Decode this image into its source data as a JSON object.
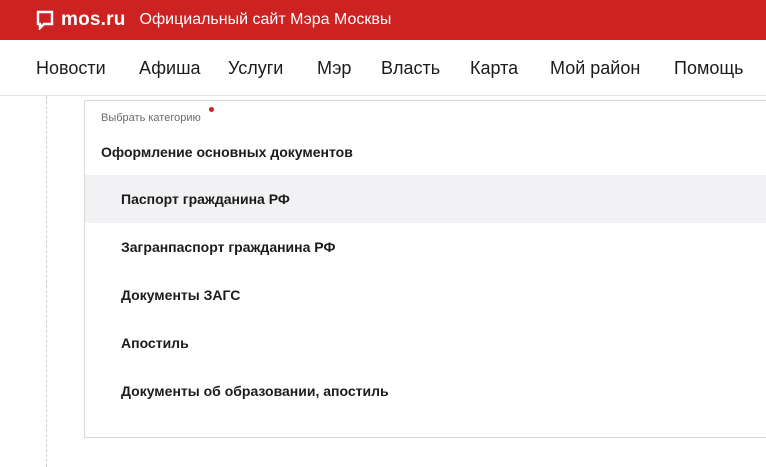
{
  "header": {
    "logo_text": "mos.ru",
    "site_title": "Официальный сайт Мэра Москвы",
    "brand_color": "#cc2222"
  },
  "nav": {
    "items": [
      {
        "label": "Новости"
      },
      {
        "label": "Афиша"
      },
      {
        "label": "Услуги"
      },
      {
        "label": "Мэр"
      },
      {
        "label": "Власть"
      },
      {
        "label": "Карта"
      },
      {
        "label": "Мой район"
      },
      {
        "label": "Помощь"
      }
    ]
  },
  "category_select": {
    "label": "Выбрать категорию",
    "selected": "Оформление основных документов",
    "options": [
      {
        "label": "Паспорт гражданина РФ",
        "highlighted": true
      },
      {
        "label": "Загранпаспорт гражданина РФ"
      },
      {
        "label": "Документы ЗАГС"
      },
      {
        "label": "Апостиль"
      },
      {
        "label": "Документы об образовании, апостиль"
      }
    ]
  }
}
